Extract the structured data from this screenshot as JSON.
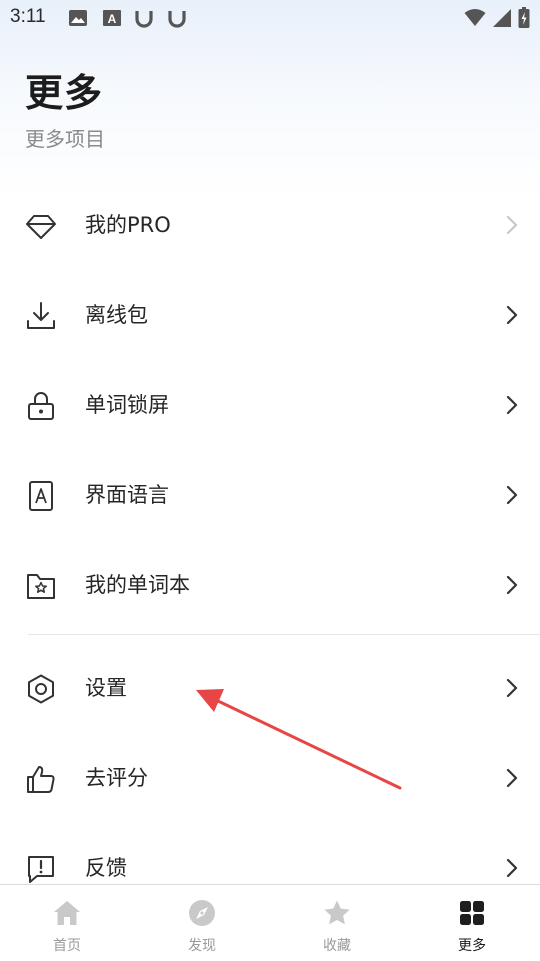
{
  "status_bar": {
    "time": "3:11",
    "icons": [
      "image-icon",
      "font-a-icon",
      "u-icon",
      "u-icon",
      "wifi-icon",
      "cell-signal-icon",
      "battery-icon"
    ]
  },
  "header": {
    "title": "更多",
    "subtitle": "更多项目"
  },
  "menu": {
    "items": [
      {
        "label": "我的PRO",
        "icon": "diamond-icon"
      },
      {
        "label": "离线包",
        "icon": "download-icon"
      },
      {
        "label": "单词锁屏",
        "icon": "lock-icon"
      },
      {
        "label": "界面语言",
        "icon": "font-a-icon"
      },
      {
        "label": "我的单词本",
        "icon": "folder-star-icon"
      },
      {
        "label": "设置",
        "icon": "hexagon-settings-icon"
      },
      {
        "label": "去评分",
        "icon": "thumbs-up-icon"
      },
      {
        "label": "反馈",
        "icon": "feedback-icon"
      }
    ]
  },
  "bottom_nav": {
    "items": [
      {
        "label": "首页",
        "icon": "home-icon"
      },
      {
        "label": "发现",
        "icon": "compass-icon"
      },
      {
        "label": "收藏",
        "icon": "star-icon"
      },
      {
        "label": "更多",
        "icon": "grid-icon"
      }
    ],
    "active": "更多"
  },
  "colors": {
    "accent_annotation": "#e84545",
    "text_primary": "#262626",
    "text_secondary": "#8a8a8a",
    "nav_inactive": "#9a9a9a"
  }
}
